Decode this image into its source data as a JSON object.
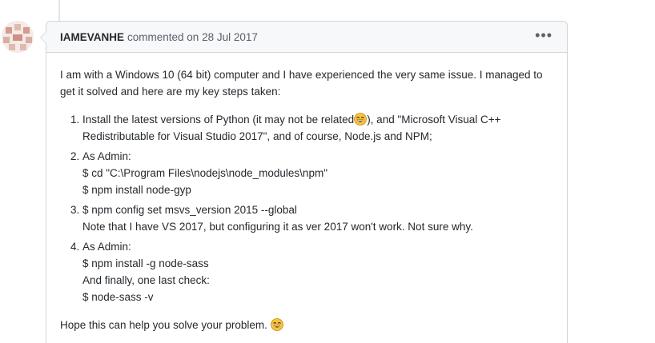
{
  "comment": {
    "author": "IAMEVANHE",
    "action": "commented on",
    "date": "28 Jul 2017",
    "menu_icon": "kebab-horizontal-icon",
    "intro": "I am with a Windows 10 (64 bit) computer and I have experienced the very same issue. I managed to get it solved and here are my key steps taken:",
    "steps": [
      {
        "lines": [
          "Install the latest versions of Python (it may not be related",
          "), and \"Microsoft Visual C++ Redistributable for Visual Studio 2017\", and of course, Node.js and NPM;"
        ]
      },
      {
        "lines": [
          "As Admin:",
          "$ cd \"C:\\Program Files\\nodejs\\node_modules\\npm\"",
          "$ npm install node-gyp"
        ]
      },
      {
        "lines": [
          "$ npm config set msvs_version 2015 --global",
          "Note that I have VS 2017, but configuring it as ver 2017 won't work. Not sure why."
        ]
      },
      {
        "lines": [
          "As Admin:",
          "$ npm install -g node-sass",
          "And finally, one last check:",
          "$ node-sass -v"
        ]
      }
    ],
    "outro": "Hope this can help you solve your problem.",
    "emoji_icon": "smile-emoji-icon"
  }
}
